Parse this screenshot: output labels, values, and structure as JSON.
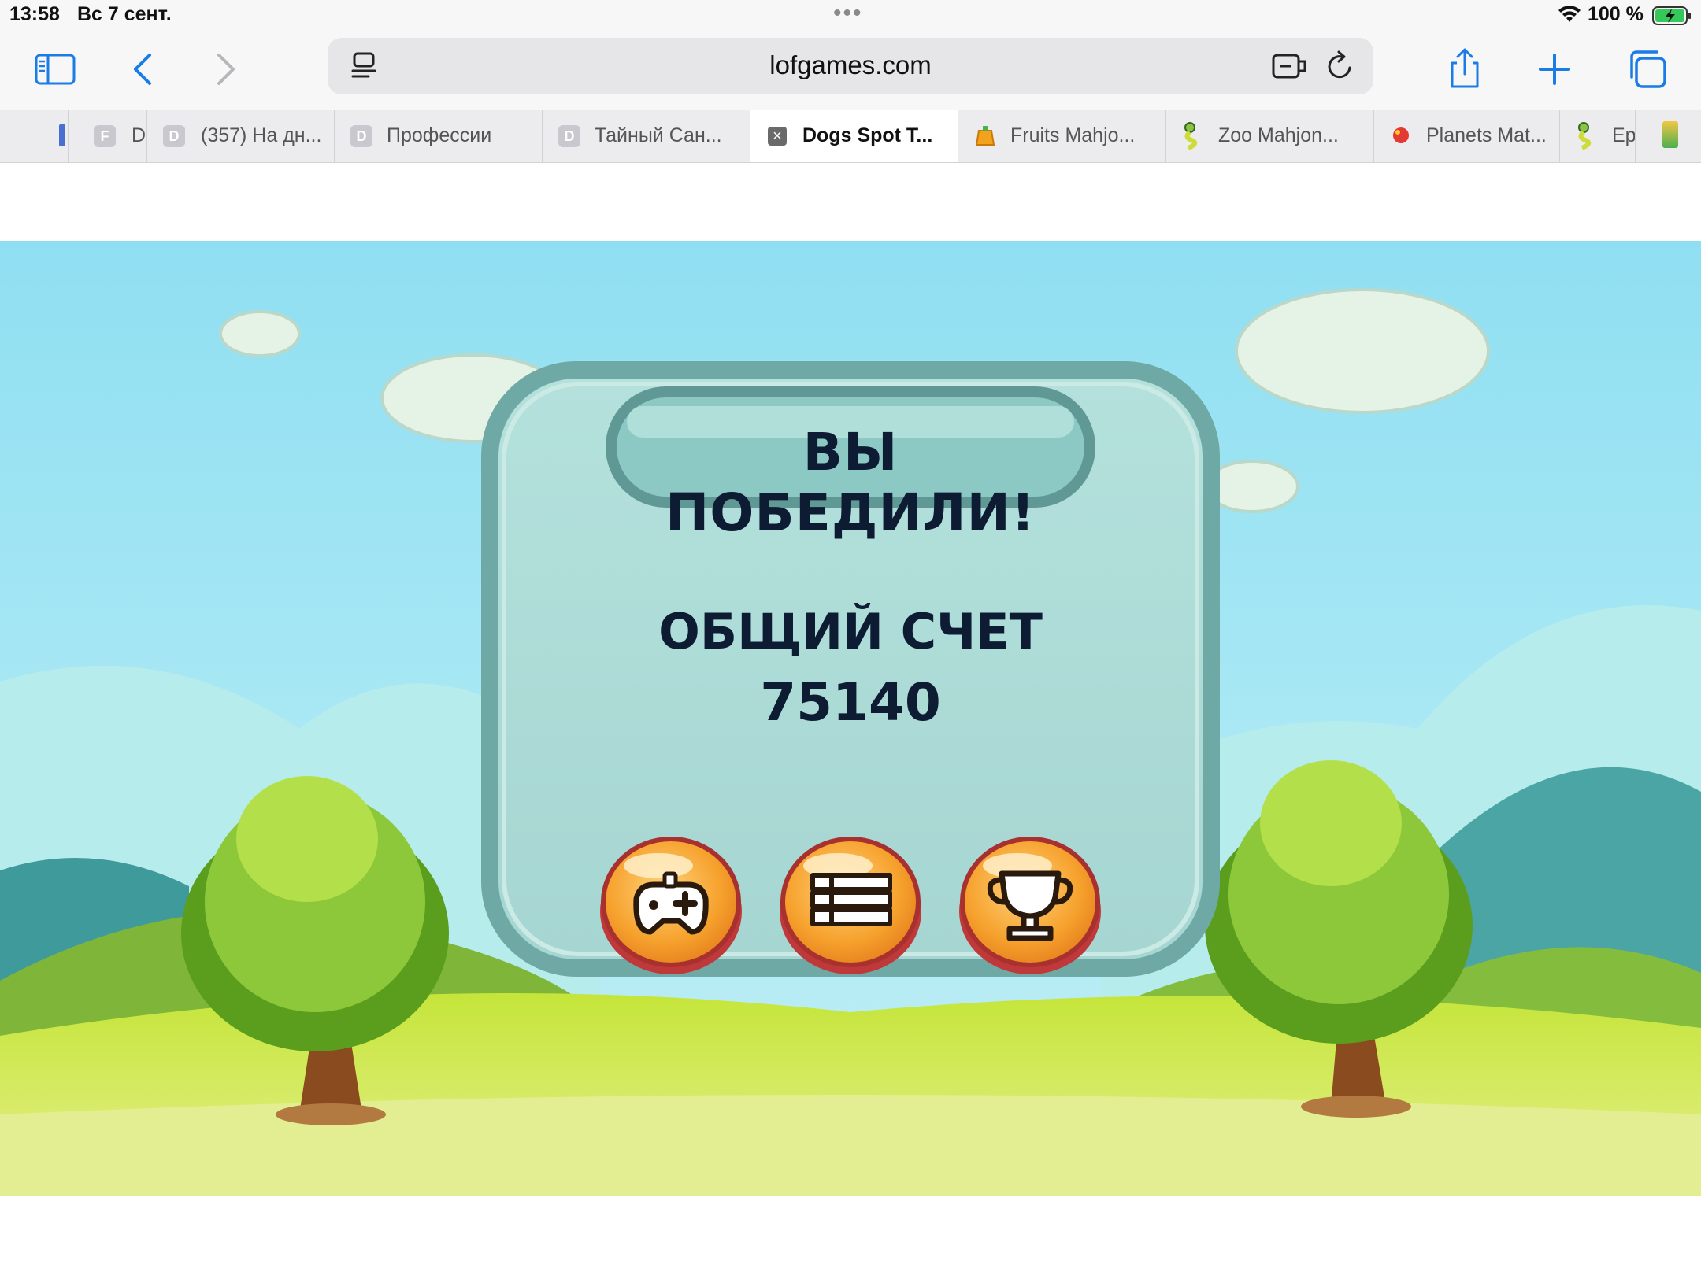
{
  "status_bar": {
    "time": "13:58",
    "date": "Вс 7 сент.",
    "dots": "•••",
    "battery_percent": "100 %"
  },
  "toolbar": {
    "url": "lofgames.com"
  },
  "tabs": [
    {
      "label": "D",
      "icon": "F"
    },
    {
      "label": "(357) На дн...",
      "icon": "D"
    },
    {
      "label": "Профессии",
      "icon": "D"
    },
    {
      "label": "Тайный Сан...",
      "icon": "D"
    },
    {
      "label": "Dogs Spot T...",
      "icon": "close",
      "active": true
    },
    {
      "label": "Fruits Mahjo...",
      "icon": "fruit-icon"
    },
    {
      "label": "Zoo Mahjon...",
      "icon": "snake-icon"
    },
    {
      "label": "Planets Mat...",
      "icon": "planet-icon"
    },
    {
      "label": "Ep",
      "icon": "snake-icon"
    }
  ],
  "game": {
    "title": "ВЫ ПОБЕДИЛИ!",
    "score_label": "ОБЩИЙ СЧЕТ",
    "score_value": "75140",
    "buttons": [
      "gamepad-icon",
      "list-icon",
      "trophy-icon"
    ]
  },
  "colors": {
    "sky": "#8fdff2",
    "panel": "#aedcd8",
    "panel_border": "#6fa9a5",
    "button_orange": "#f5a02a",
    "button_rim": "#c0393a",
    "accent_blue": "#1a7ce4"
  }
}
